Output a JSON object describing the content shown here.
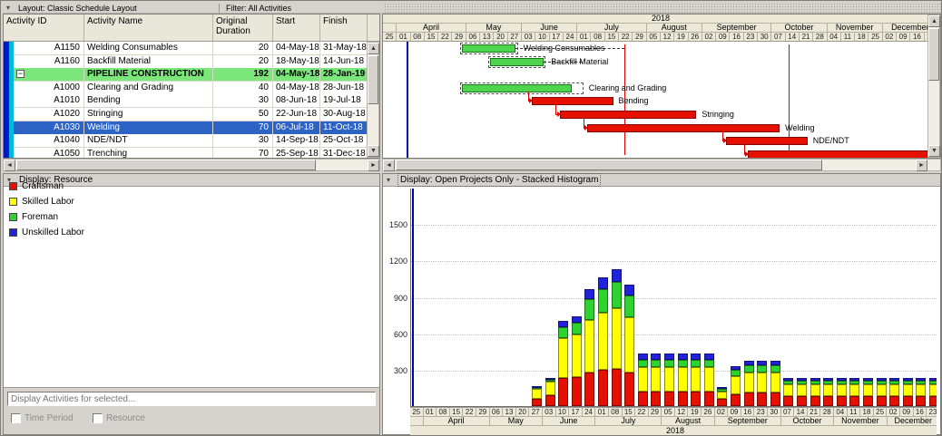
{
  "toolbar": {
    "layout_label": "Layout: Classic Schedule Layout",
    "filter_label": "Filter: All Activities"
  },
  "activity_table": {
    "columns": [
      "Activity ID",
      "Activity Name",
      "Original Duration",
      "Start",
      "Finish"
    ],
    "rows": [
      {
        "id": "A1150",
        "name": "Welding Consumables",
        "duration": "20",
        "start": "04-May-18",
        "finish": "31-May-18",
        "style": "normal"
      },
      {
        "id": "A1160",
        "name": "Backfill Material",
        "duration": "20",
        "start": "18-May-18",
        "finish": "14-Jun-18",
        "style": "normal"
      },
      {
        "id": "",
        "name": "PIPELINE CONSTRUCTION",
        "duration": "192",
        "start": "04-May-18",
        "finish": "28-Jan-19",
        "style": "summary"
      },
      {
        "id": "A1000",
        "name": "Clearing and Grading",
        "duration": "40",
        "start": "04-May-18",
        "finish": "28-Jun-18",
        "style": "normal"
      },
      {
        "id": "A1010",
        "name": "Bending",
        "duration": "30",
        "start": "08-Jun-18",
        "finish": "19-Jul-18",
        "style": "normal"
      },
      {
        "id": "A1020",
        "name": "Stringing",
        "duration": "50",
        "start": "22-Jun-18",
        "finish": "30-Aug-18",
        "style": "normal"
      },
      {
        "id": "A1030",
        "name": "Welding",
        "duration": "70",
        "start": "06-Jul-18",
        "finish": "11-Oct-18",
        "style": "selected"
      },
      {
        "id": "A1040",
        "name": "NDE/NDT",
        "duration": "30",
        "start": "14-Sep-18",
        "finish": "25-Oct-18",
        "style": "normal"
      },
      {
        "id": "A1050",
        "name": "Trenching",
        "duration": "70",
        "start": "25-Sep-18",
        "finish": "31-Dec-18",
        "style": "normal"
      }
    ]
  },
  "timeline": {
    "year": "2018",
    "months": [
      {
        "label": "",
        "weeks": [
          "25"
        ]
      },
      {
        "label": "April",
        "weeks": [
          "01",
          "08",
          "15",
          "22",
          "29"
        ]
      },
      {
        "label": "May",
        "weeks": [
          "06",
          "13",
          "20",
          "27"
        ]
      },
      {
        "label": "June",
        "weeks": [
          "03",
          "10",
          "17",
          "24"
        ]
      },
      {
        "label": "July",
        "weeks": [
          "01",
          "08",
          "15",
          "22",
          "29"
        ]
      },
      {
        "label": "August",
        "weeks": [
          "05",
          "12",
          "19",
          "26"
        ]
      },
      {
        "label": "September",
        "weeks": [
          "02",
          "09",
          "16",
          "23",
          "30"
        ]
      },
      {
        "label": "October",
        "weeks": [
          "07",
          "14",
          "21",
          "28"
        ]
      },
      {
        "label": "November",
        "weeks": [
          "04",
          "11",
          "18",
          "25"
        ]
      },
      {
        "label": "December",
        "weeks": [
          "02",
          "09",
          "16",
          "23"
        ]
      }
    ]
  },
  "gantt": {
    "colors": {
      "green_bar": "#4fd44f",
      "red_bar": "#e61000",
      "relationship": "#e00000",
      "data_date": "#0000b4"
    },
    "bars": [
      {
        "row": 0,
        "start_day": 40,
        "end_day": 67,
        "color": "green",
        "label": "Welding Consumables",
        "baseline": true,
        "baseline_extra_days": 1
      },
      {
        "row": 1,
        "start_day": 54,
        "end_day": 81,
        "color": "green",
        "label": "Backfill Material",
        "baseline": true,
        "baseline_extra_days": 1
      },
      {
        "row": 3,
        "start_day": 40,
        "end_day": 95,
        "color": "green",
        "label": "Clearing and Grading",
        "baseline": true,
        "baseline_extra_days": 6
      },
      {
        "row": 4,
        "start_day": 75,
        "end_day": 116,
        "color": "red",
        "label": "Bending"
      },
      {
        "row": 5,
        "start_day": 89,
        "end_day": 158,
        "color": "red",
        "label": "Stringing"
      },
      {
        "row": 6,
        "start_day": 103,
        "end_day": 200,
        "color": "red",
        "label": "Welding"
      },
      {
        "row": 7,
        "start_day": 173,
        "end_day": 214,
        "color": "red",
        "label": "NDE/NDT"
      },
      {
        "row": 8,
        "start_day": 184,
        "end_day": 281,
        "color": "red",
        "label": ""
      }
    ],
    "links": {
      "data_date_day": 12,
      "dashed": [
        {
          "row": 0,
          "from_day": 67,
          "to_day": 121.5
        },
        {
          "row": 1,
          "from_day": 81,
          "to_day": 100
        }
      ],
      "verticals": [
        {
          "day": 121.5
        },
        {
          "day": 204.5
        }
      ],
      "connectors": [
        {
          "drop_day": 73,
          "from_row": 3,
          "to_row": 4,
          "arrow_day": 75
        },
        {
          "drop_day": 87,
          "from_row": 4,
          "to_row": 5,
          "arrow_day": 89
        },
        {
          "drop_day": 101,
          "from_row": 5,
          "to_row": 6,
          "arrow_day": 103
        },
        {
          "drop_day": 171,
          "from_row": 6,
          "to_row": 7,
          "arrow_day": 173
        },
        {
          "drop_day": 182,
          "from_row": 7,
          "to_row": 8,
          "arrow_day": 184
        }
      ]
    }
  },
  "resource_panel": {
    "title": "Display: Resource",
    "legend": [
      {
        "label": "Craftsman",
        "color": "#e61000"
      },
      {
        "label": "Skilled Labor",
        "color": "#ffff00"
      },
      {
        "label": "Foreman",
        "color": "#2fd32f"
      },
      {
        "label": "Unskilled Labor",
        "color": "#2222dd"
      }
    ],
    "filter_placeholder": "Display Activities for selected...",
    "checkboxes": [
      "Time Period",
      "Resource"
    ]
  },
  "histogram_panel": {
    "title": "Display: Open Projects Only - Stacked Histogram"
  },
  "chart_data": {
    "type": "bar",
    "subtype": "stacked-histogram",
    "title": "Open Projects Only - Stacked Histogram",
    "x_axis_year": "2018",
    "x_unit": "week-starting",
    "x_labels": [
      "25",
      "01",
      "08",
      "15",
      "22",
      "29",
      "06",
      "13",
      "20",
      "27",
      "03",
      "10",
      "17",
      "24",
      "01",
      "08",
      "15",
      "22",
      "29",
      "05",
      "12",
      "19",
      "26",
      "02",
      "09",
      "16",
      "23",
      "30",
      "07",
      "14",
      "21",
      "28",
      "04",
      "11",
      "18",
      "25",
      "02",
      "09",
      "16",
      "23"
    ],
    "ylim": [
      0,
      1800
    ],
    "yticks": [
      300,
      600,
      900,
      1200,
      1500
    ],
    "legend_position": "left-panel",
    "grid": "horizontal-dotted",
    "series": [
      {
        "name": "Craftsman",
        "color": "#e61000",
        "values": [
          0,
          0,
          0,
          0,
          0,
          0,
          0,
          0,
          0,
          60,
          90,
          230,
          240,
          280,
          300,
          310,
          280,
          120,
          120,
          120,
          120,
          120,
          120,
          60,
          100,
          110,
          110,
          110,
          80,
          80,
          80,
          80,
          80,
          80,
          80,
          80,
          80,
          80,
          80,
          80
        ]
      },
      {
        "name": "Skilled Labor",
        "color": "#ffff00",
        "values": [
          0,
          0,
          0,
          0,
          0,
          0,
          0,
          0,
          0,
          80,
          110,
          330,
          350,
          430,
          470,
          500,
          450,
          200,
          200,
          200,
          200,
          200,
          200,
          60,
          150,
          170,
          170,
          170,
          100,
          100,
          100,
          100,
          100,
          100,
          100,
          100,
          100,
          100,
          100,
          100
        ]
      },
      {
        "name": "Foreman",
        "color": "#2fd32f",
        "values": [
          0,
          0,
          0,
          0,
          0,
          0,
          0,
          0,
          0,
          10,
          20,
          90,
          100,
          170,
          190,
          210,
          180,
          60,
          60,
          60,
          60,
          60,
          60,
          20,
          50,
          55,
          55,
          55,
          30,
          30,
          30,
          30,
          30,
          30,
          30,
          30,
          30,
          30,
          30,
          30
        ]
      },
      {
        "name": "Unskilled Labor",
        "color": "#2222dd",
        "values": [
          0,
          0,
          0,
          0,
          0,
          0,
          0,
          0,
          0,
          10,
          10,
          50,
          50,
          80,
          100,
          110,
          90,
          50,
          50,
          50,
          50,
          50,
          50,
          10,
          30,
          35,
          35,
          35,
          20,
          20,
          20,
          20,
          20,
          20,
          20,
          20,
          20,
          20,
          20,
          20
        ]
      }
    ]
  }
}
